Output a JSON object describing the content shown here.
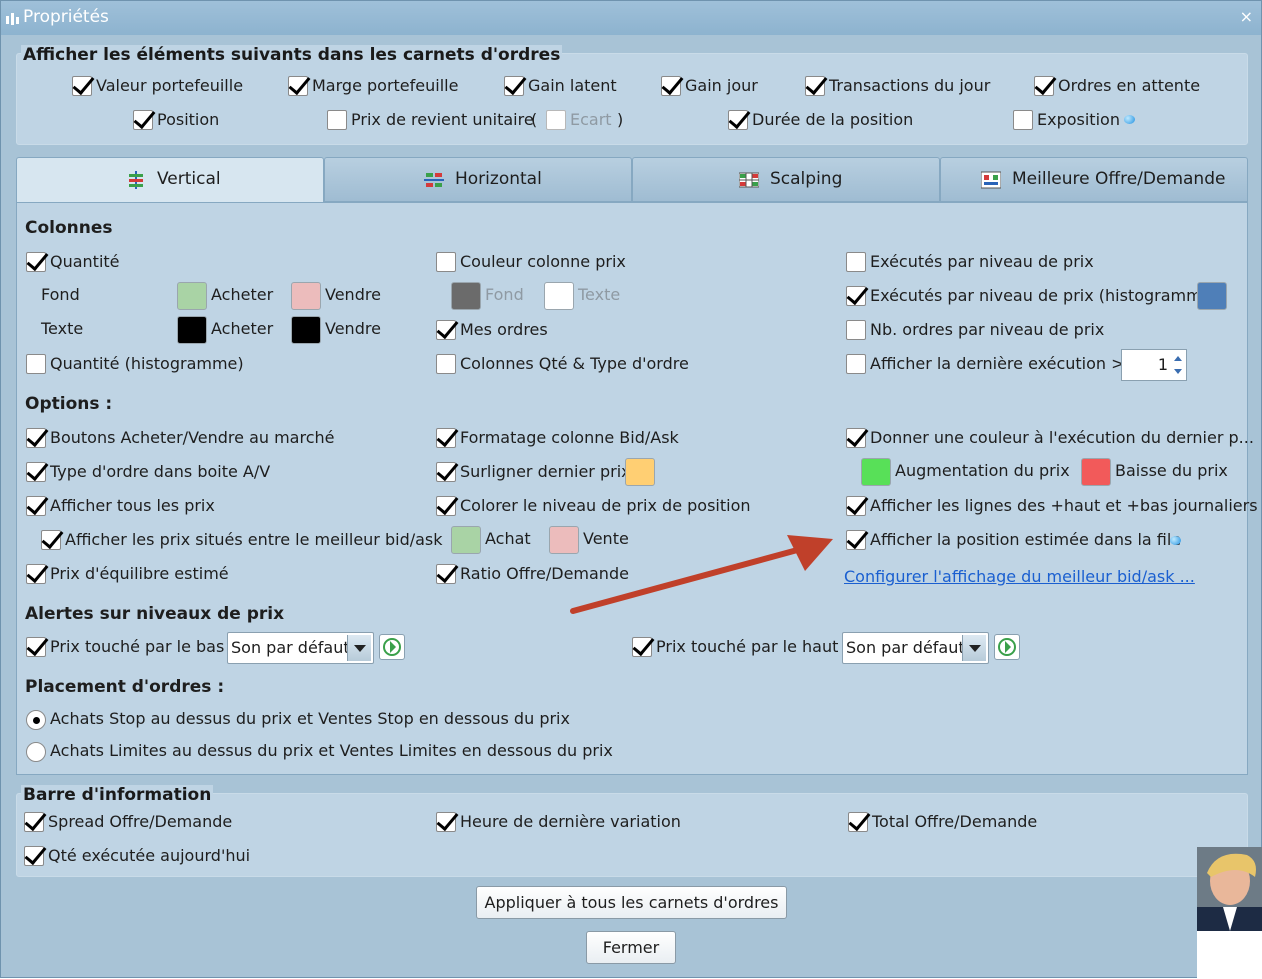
{
  "window": {
    "title": "Propriétés",
    "close_glyph": "×"
  },
  "display_group": {
    "legend": "Afficher les éléments suivants dans les carnets d'ordres",
    "items": [
      {
        "label": "Valeur portefeuille",
        "checked": true
      },
      {
        "label": "Marge portefeuille",
        "checked": true
      },
      {
        "label": "Gain latent",
        "checked": true
      },
      {
        "label": "Gain jour",
        "checked": true
      },
      {
        "label": "Transactions du jour",
        "checked": true
      },
      {
        "label": "Ordres en attente",
        "checked": true
      },
      {
        "label": "Position",
        "checked": true
      },
      {
        "label": "Prix de revient unitaire",
        "checked": false
      },
      {
        "label": "Durée de la position",
        "checked": true
      },
      {
        "label": "Exposition",
        "checked": false
      }
    ],
    "paren_open": "(",
    "ecart_label": "Ecart",
    "paren_close": ")"
  },
  "tabs": [
    {
      "label": "Vertical",
      "icon": "vertical-book-icon",
      "active": true
    },
    {
      "label": "Horizontal",
      "icon": "horizontal-book-icon",
      "active": false
    },
    {
      "label": "Scalping",
      "icon": "scalping-grid-icon",
      "active": false
    },
    {
      "label": "Meilleure Offre/Demande",
      "icon": "best-bid-ask-icon",
      "active": false
    }
  ],
  "columns": {
    "title": "Colonnes",
    "quantite": "Quantité",
    "fond": "Fond",
    "texte": "Texte",
    "acheter": "Acheter",
    "vendre": "Vendre",
    "quantite_histo": "Quantité (histogramme)",
    "couleur_colonne_prix": "Couleur colonne prix",
    "fond_disabled": "Fond",
    "texte_disabled": "Texte",
    "mes_ordres": "Mes ordres",
    "colonnes_qte_type": "Colonnes Qté & Type d'ordre",
    "executes_niveau": "Exécutés par niveau de prix",
    "executes_histo": "Exécutés par niveau de prix (histogramme)",
    "nb_ordres": "Nb. ordres par niveau de prix",
    "derniere_execution": "Afficher la dernière exécution >=",
    "derniere_execution_value": "1",
    "colors": {
      "fond_acheter": "#a9d3a5",
      "fond_vendre": "#ecbcbc",
      "texte_acheter": "#000000",
      "texte_vendre": "#000000",
      "fond_prix": "#6b6b6b",
      "texte_prix": "#ffffff",
      "histogram": "#4f7fb8"
    }
  },
  "options": {
    "title": "Options :",
    "boutons_marche": "Boutons Acheter/Vendre au marché",
    "type_ordre": "Type d'ordre dans boite A/V",
    "afficher_tous_prix": "Afficher tous les prix",
    "prix_entre_bid_ask": "Afficher les prix situés entre le meilleur bid/ask",
    "prix_equilibre": "Prix d'équilibre estimé",
    "formatage_bid_ask": "Formatage colonne Bid/Ask",
    "surligner_dernier_prix": "Surligner dernier prix",
    "colorer_niveau_position": "Colorer le niveau de prix de position",
    "achat": "Achat",
    "vente": "Vente",
    "ratio_offre_demande": "Ratio Offre/Demande",
    "donner_couleur": "Donner une couleur à l'exécution du dernier p...",
    "augmentation": "Augmentation du prix",
    "baisse": "Baisse du prix",
    "lignes_haut_bas": "Afficher les lignes des +haut et +bas journaliers",
    "position_file": "Afficher la position estimée dans la file",
    "configurer_link": "Configurer l'affichage du meilleur bid/ask ...",
    "colors": {
      "surligner": "#ffcf73",
      "achat": "#a9d3a5",
      "vente": "#ecbcbc",
      "augmentation": "#58e058",
      "baisse": "#f25a5a",
      "arrow": "#c0402a"
    }
  },
  "alerts": {
    "title": "Alertes sur niveaux de prix",
    "prix_bas": "Prix touché par le bas",
    "prix_haut": "Prix touché par le haut",
    "sound_bas": "Son par défaut",
    "sound_haut": "Son par défaut"
  },
  "placement": {
    "title": "Placement d'ordres :",
    "stop": "Achats Stop au dessus du prix et Ventes Stop en dessous du prix",
    "limites": "Achats Limites au dessus du prix et Ventes Limites en dessous du prix"
  },
  "info_bar": {
    "legend": "Barre d'information",
    "spread": "Spread Offre/Demande",
    "heure": "Heure de dernière variation",
    "total": "Total Offre/Demande",
    "qte_executee": "Qté exécutée aujourd'hui"
  },
  "buttons": {
    "apply_all": "Appliquer à tous les carnets d'ordres",
    "close": "Fermer"
  }
}
